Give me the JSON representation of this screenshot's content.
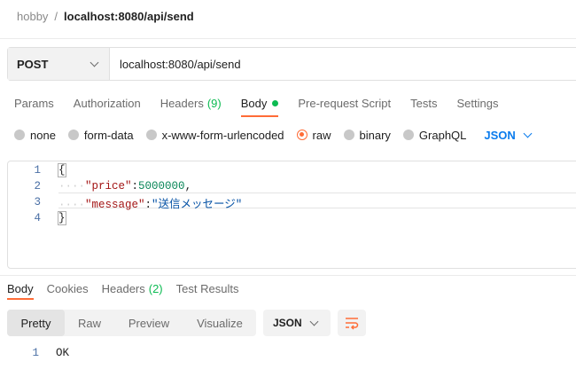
{
  "breadcrumb": {
    "parent": "hobby",
    "separator": "/",
    "current": "localhost:8080/api/send"
  },
  "request": {
    "method": "POST",
    "url": "localhost:8080/api/send"
  },
  "request_tabs": [
    {
      "label": "Params"
    },
    {
      "label": "Authorization"
    },
    {
      "label": "Headers",
      "count": "(9)"
    },
    {
      "label": "Body"
    },
    {
      "label": "Pre-request Script"
    },
    {
      "label": "Tests"
    },
    {
      "label": "Settings"
    }
  ],
  "body_types": [
    "none",
    "form-data",
    "x-www-form-urlencoded",
    "raw",
    "binary",
    "GraphQL"
  ],
  "body_type_selected": "raw",
  "body_language": "JSON",
  "editor": {
    "lines": [
      {
        "no": "1",
        "text": "{"
      },
      {
        "no": "2",
        "key": "\"price\"",
        "colon": ":",
        "value": "5000000",
        "comma": ","
      },
      {
        "no": "3",
        "key": "\"message\"",
        "colon": ":",
        "value": "\"送信メッセージ\""
      },
      {
        "no": "4",
        "text": "}"
      }
    ]
  },
  "response_tabs": [
    {
      "label": "Body"
    },
    {
      "label": "Cookies"
    },
    {
      "label": "Headers",
      "count": "(2)"
    },
    {
      "label": "Test Results"
    }
  ],
  "response_views": [
    "Pretty",
    "Raw",
    "Preview",
    "Visualize"
  ],
  "response_format": "JSON",
  "response_body": {
    "line_no": "1",
    "text": "OK"
  },
  "colors": {
    "accent": "#ff6c37",
    "count_green": "#0cbb52",
    "link_blue": "#097bed"
  },
  "icons": {
    "method_dropdown": "chevron-down-icon",
    "wrap": "wrap-lines-icon"
  }
}
